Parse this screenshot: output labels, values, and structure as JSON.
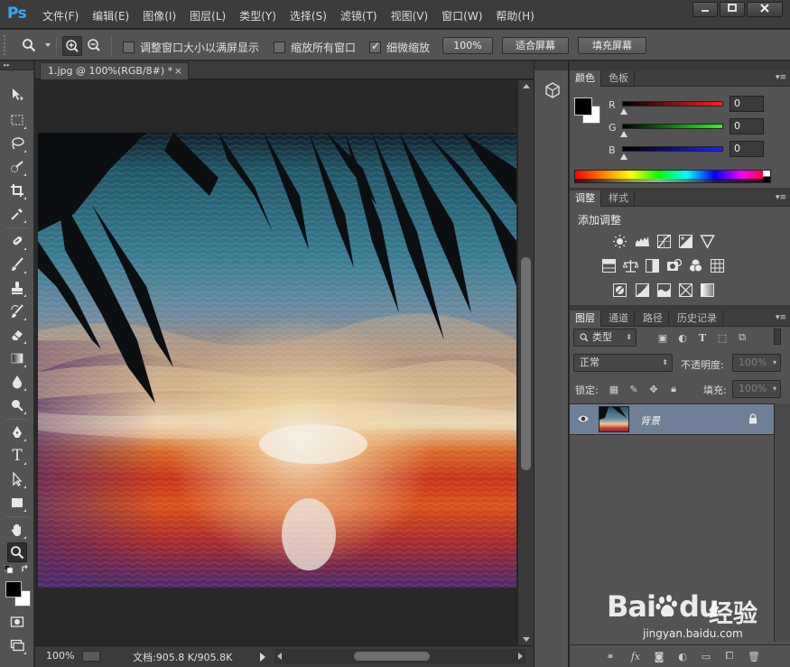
{
  "app": {
    "logo": "Ps",
    "menus": [
      "文件(F)",
      "编辑(E)",
      "图像(I)",
      "图层(L)",
      "类型(Y)",
      "选择(S)",
      "滤镜(T)",
      "视图(V)",
      "窗口(W)",
      "帮助(H)"
    ],
    "window_buttons": [
      "minimize",
      "maximize",
      "close"
    ]
  },
  "options_bar": {
    "tool_icon": "zoom-tool-icon",
    "zoom_in_icon": "zoom-in-icon",
    "zoom_out_icon": "zoom-out-icon",
    "resize_windows_label": "调整窗口大小以满屏显示",
    "resize_windows_checked": false,
    "zoom_all_windows_label": "缩放所有窗口",
    "zoom_all_windows_checked": false,
    "scrubby_zoom_label": "细微缩放",
    "scrubby_zoom_checked": true,
    "actual_pixels_label": "100%",
    "fit_screen_label": "适合屏幕",
    "fill_screen_label": "填充屏幕"
  },
  "document": {
    "tab_title": "1.jpg @ 100%(RGB/8#) *",
    "close_glyph": "×",
    "status_zoom": "100%",
    "status_doc": "文档:905.8 K/905.8K"
  },
  "tools": [
    "move-tool-icon",
    "marquee-tool-icon",
    "lasso-tool-icon",
    "quick-selection-tool-icon",
    "crop-tool-icon",
    "eyedropper-tool-icon",
    "healing-brush-tool-icon",
    "brush-tool-icon",
    "clone-stamp-tool-icon",
    "history-brush-tool-icon",
    "eraser-tool-icon",
    "gradient-tool-icon",
    "blur-tool-icon",
    "dodge-tool-icon",
    "pen-tool-icon",
    "type-tool-icon",
    "path-selection-tool-icon",
    "rectangle-tool-icon",
    "hand-tool-icon",
    "zoom-tool-icon"
  ],
  "type_tool_glyph": "T",
  "color_panel": {
    "tabs": [
      "颜色",
      "色板"
    ],
    "active_tab": 0,
    "foreground": "#000000",
    "background": "#ffffff",
    "channels": [
      {
        "label": "R",
        "value": "0",
        "color": "#ff2020"
      },
      {
        "label": "G",
        "value": "0",
        "color": "#20ff20"
      },
      {
        "label": "B",
        "value": "0",
        "color": "#2020ff"
      }
    ]
  },
  "adjustments_panel": {
    "tabs": [
      "调整",
      "样式"
    ],
    "active_tab": 0,
    "title": "添加调整",
    "icons": [
      "brightness-contrast-icon",
      "levels-icon",
      "curves-icon",
      "exposure-icon",
      "vibrance-icon",
      "hue-saturation-icon",
      "color-balance-icon",
      "black-white-icon",
      "photo-filter-icon",
      "channel-mixer-icon",
      "color-lookup-icon",
      "invert-icon",
      "posterize-icon",
      "threshold-icon",
      "selective-color-icon",
      "gradient-map-icon"
    ]
  },
  "layers_panel": {
    "tabs": [
      "图层",
      "通道",
      "路径",
      "历史记录"
    ],
    "active_tab": 0,
    "filter_label": "类型",
    "blend_mode": "正常",
    "opacity_label": "不透明度:",
    "opacity_value": "100%",
    "lock_label": "锁定:",
    "fill_label": "填充:",
    "fill_value": "100%",
    "layers": [
      {
        "name": "背景",
        "visible": true,
        "locked": true
      }
    ],
    "footer_icons": [
      "link-layers-icon",
      "fx-icon",
      "add-mask-icon",
      "adjustment-layer-icon",
      "new-group-icon",
      "new-layer-icon",
      "delete-layer-icon"
    ]
  },
  "watermark": {
    "brand": "Bai",
    "brand_suffix": "du",
    "cn": "经验",
    "url": "jingyan.baidu.com"
  },
  "colors": {
    "ps_blue": "#31a8ff",
    "panel_bg": "#535353",
    "selected_layer": "#6f7f98"
  }
}
